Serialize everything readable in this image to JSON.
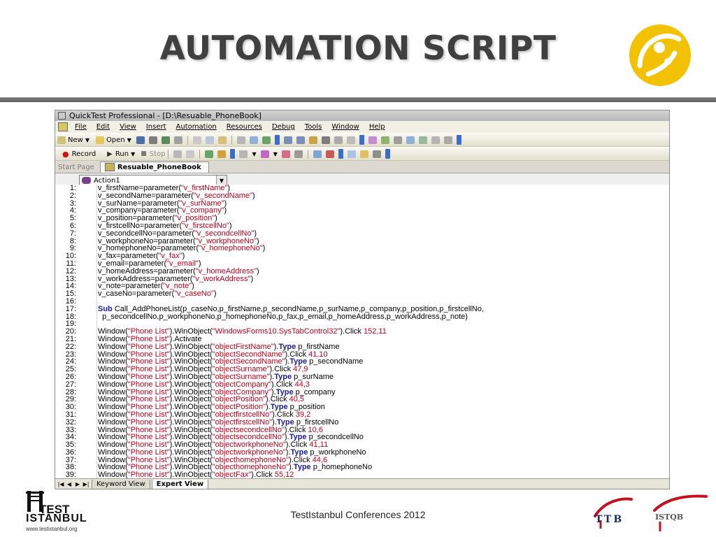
{
  "slide": {
    "title": "AUTOMATION SCRIPT",
    "footer_text": "TestIstanbul Conferences 2012",
    "logo_test": "TEST",
    "logo_istanbul": "ISTANBUL",
    "logo_url": "www.testistanbul.org",
    "ttb_label": "TTB",
    "istqb_label": "ISTQB",
    "brand_color": "#f2c200"
  },
  "app": {
    "title": "QuickTest Professional - [D:\\Resuable_PhoneBook]",
    "menu": [
      "File",
      "Edit",
      "View",
      "Insert",
      "Automation",
      "Resources",
      "Debug",
      "Tools",
      "Window",
      "Help"
    ],
    "toolbar1": {
      "new_label": "New",
      "open_label": "Open"
    },
    "toolbar2": {
      "record_label": "Record",
      "run_label": "Run",
      "stop_label": "Stop"
    },
    "tabs": {
      "start": "Start Page",
      "doc": "Resuable_PhoneBook"
    },
    "action_select": "Action1",
    "bottom_tabs": [
      "Keyword View",
      "Expert View"
    ]
  },
  "code_lines": [
    {
      "n": "1:",
      "t": [
        [
          "v_firstName=parameter(",
          ""
        ],
        [
          "\"v_firstName\"",
          "s"
        ],
        [
          ")",
          ""
        ]
      ]
    },
    {
      "n": "2:",
      "t": [
        [
          "v_secondName=parameter(",
          ""
        ],
        [
          "\"v_secondName\"",
          "s"
        ],
        [
          ")",
          ""
        ]
      ]
    },
    {
      "n": "3:",
      "t": [
        [
          "v_surName=parameter(",
          ""
        ],
        [
          "\"v_surName\"",
          "s"
        ],
        [
          ")",
          ""
        ]
      ]
    },
    {
      "n": "4:",
      "t": [
        [
          "v_company=parameter(",
          ""
        ],
        [
          "\"v_company\"",
          "s"
        ],
        [
          ")",
          ""
        ]
      ]
    },
    {
      "n": "5:",
      "t": [
        [
          "v_position=parameter(",
          ""
        ],
        [
          "\"v_position\"",
          "s"
        ],
        [
          ")",
          ""
        ]
      ]
    },
    {
      "n": "6:",
      "t": [
        [
          "v_firstcellNo=parameter(",
          ""
        ],
        [
          "\"v_firstcellNo\"",
          "s"
        ],
        [
          ")",
          ""
        ]
      ]
    },
    {
      "n": "7:",
      "t": [
        [
          "v_secondcellNo=parameter(",
          ""
        ],
        [
          "\"v_secondcellNo\"",
          "s"
        ],
        [
          ")",
          ""
        ]
      ]
    },
    {
      "n": "8:",
      "t": [
        [
          "v_workphoneNo=parameter(",
          ""
        ],
        [
          "\"v_workphoneNo\"",
          "s"
        ],
        [
          ")",
          ""
        ]
      ]
    },
    {
      "n": "9:",
      "t": [
        [
          "v_homephoneNo=parameter(",
          ""
        ],
        [
          "\"v_homephoneNo\"",
          "s"
        ],
        [
          ")",
          ""
        ]
      ]
    },
    {
      "n": "10:",
      "t": [
        [
          "v_fax=parameter(",
          ""
        ],
        [
          "\"v_fax\"",
          "s"
        ],
        [
          ")",
          ""
        ]
      ]
    },
    {
      "n": "11:",
      "t": [
        [
          "v_email=parameter(",
          ""
        ],
        [
          "\"v_email\"",
          "s"
        ],
        [
          ")",
          ""
        ]
      ]
    },
    {
      "n": "12:",
      "t": [
        [
          "v_homeAddress=parameter(",
          ""
        ],
        [
          "\"v_homeAddress\"",
          "s"
        ],
        [
          ")",
          ""
        ]
      ]
    },
    {
      "n": "13:",
      "t": [
        [
          "v_workAddress=parameter(",
          ""
        ],
        [
          "\"v_workAddress\"",
          "s"
        ],
        [
          ")",
          ""
        ]
      ]
    },
    {
      "n": "14:",
      "t": [
        [
          "v_note=parameter(",
          ""
        ],
        [
          "\"v_note\"",
          "s"
        ],
        [
          ")",
          ""
        ]
      ]
    },
    {
      "n": "15:",
      "t": [
        [
          "v_caseNo=parameter(",
          ""
        ],
        [
          "\"v_caseNo\"",
          "s"
        ],
        [
          ")",
          ""
        ]
      ]
    },
    {
      "n": "16:",
      "t": []
    },
    {
      "n": "17:",
      "t": [
        [
          "Sub",
          "k"
        ],
        [
          " Call_AddPhoneList(p_caseNo,p_firstName,p_secondName,p_surName,p_company,p_position,p_firstcellNo,",
          ""
        ]
      ]
    },
    {
      "n": "18:",
      "t": [
        [
          "  p_secondcellNo,p_workphoneNo,p_homephoneNo,p_fax,p_email,p_homeAddress,p_workAddress,p_note)",
          ""
        ]
      ]
    },
    {
      "n": "19:",
      "t": []
    },
    {
      "n": "20:",
      "t": [
        [
          "Window(",
          ""
        ],
        [
          "\"Phone List\"",
          "s"
        ],
        [
          ").WinObject(",
          ""
        ],
        [
          "\"WindowsForms10.SysTabControl32\"",
          "s"
        ],
        [
          ").Click ",
          ""
        ],
        [
          "152,11",
          "n"
        ]
      ]
    },
    {
      "n": "21:",
      "t": [
        [
          "Window(",
          ""
        ],
        [
          "\"Phone List\"",
          "s"
        ],
        [
          ").Activate",
          ""
        ]
      ]
    },
    {
      "n": "22:",
      "t": [
        [
          "Window(",
          ""
        ],
        [
          "\"Phone List\"",
          "s"
        ],
        [
          ").WinObject(",
          ""
        ],
        [
          "\"objectFirstName\"",
          "s"
        ],
        [
          ").",
          ""
        ],
        [
          "Type",
          "k"
        ],
        [
          " p_firstName",
          ""
        ]
      ]
    },
    {
      "n": "23:",
      "t": [
        [
          "Window(",
          ""
        ],
        [
          "\"Phone List\"",
          "s"
        ],
        [
          ").WinObject(",
          ""
        ],
        [
          "\"objectSecondName\"",
          "s"
        ],
        [
          ").Click ",
          ""
        ],
        [
          "41,10",
          "n"
        ]
      ]
    },
    {
      "n": "24:",
      "t": [
        [
          "Window(",
          ""
        ],
        [
          "\"Phone List\"",
          "s"
        ],
        [
          ").WinObject(",
          ""
        ],
        [
          "\"objectSecondName\"",
          "s"
        ],
        [
          ").",
          ""
        ],
        [
          "Type",
          "k"
        ],
        [
          " p_secondName",
          ""
        ]
      ]
    },
    {
      "n": "25:",
      "t": [
        [
          "Window(",
          ""
        ],
        [
          "\"Phone List\"",
          "s"
        ],
        [
          ").WinObject(",
          ""
        ],
        [
          "\"objectSurname\"",
          "s"
        ],
        [
          ").Click ",
          ""
        ],
        [
          "47,9",
          "n"
        ]
      ]
    },
    {
      "n": "26:",
      "t": [
        [
          "Window(",
          ""
        ],
        [
          "\"Phone List\"",
          "s"
        ],
        [
          ").WinObject(",
          ""
        ],
        [
          "\"objectSurname\"",
          "s"
        ],
        [
          ").",
          ""
        ],
        [
          "Type",
          "k"
        ],
        [
          " p_surName",
          ""
        ]
      ]
    },
    {
      "n": "27:",
      "t": [
        [
          "Window(",
          ""
        ],
        [
          "\"Phone List\"",
          "s"
        ],
        [
          ").WinObject(",
          ""
        ],
        [
          "\"objectCompany\"",
          "s"
        ],
        [
          ").Click ",
          ""
        ],
        [
          "44,3",
          "n"
        ]
      ]
    },
    {
      "n": "28:",
      "t": [
        [
          "Window(",
          ""
        ],
        [
          "\"Phone List\"",
          "s"
        ],
        [
          ").WinObject(",
          ""
        ],
        [
          "\"objectCompany\"",
          "s"
        ],
        [
          ").",
          ""
        ],
        [
          "Type",
          "k"
        ],
        [
          " p_company",
          ""
        ]
      ]
    },
    {
      "n": "29:",
      "t": [
        [
          "Window(",
          ""
        ],
        [
          "\"Phone List\"",
          "s"
        ],
        [
          ").WinObject(",
          ""
        ],
        [
          "\"objectPosition\"",
          "s"
        ],
        [
          ").Click ",
          ""
        ],
        [
          "40,5",
          "n"
        ]
      ]
    },
    {
      "n": "30:",
      "t": [
        [
          "Window(",
          ""
        ],
        [
          "\"Phone List\"",
          "s"
        ],
        [
          ").WinObject(",
          ""
        ],
        [
          "\"objectPosition\"",
          "s"
        ],
        [
          ").",
          ""
        ],
        [
          "Type",
          "k"
        ],
        [
          " p_position",
          ""
        ]
      ]
    },
    {
      "n": "31:",
      "t": [
        [
          "Window(",
          ""
        ],
        [
          "\"Phone List\"",
          "s"
        ],
        [
          ").WinObject(",
          ""
        ],
        [
          "\"objectfirstcellNo\"",
          "s"
        ],
        [
          ").Click ",
          ""
        ],
        [
          "39,2",
          "n"
        ]
      ]
    },
    {
      "n": "32:",
      "t": [
        [
          "Window(",
          ""
        ],
        [
          "\"Phone List\"",
          "s"
        ],
        [
          ").WinObject(",
          ""
        ],
        [
          "\"objectfirstcellNo\"",
          "s"
        ],
        [
          ").",
          ""
        ],
        [
          "Type",
          "k"
        ],
        [
          " p_firstcellNo",
          ""
        ]
      ]
    },
    {
      "n": "33:",
      "t": [
        [
          "Window(",
          ""
        ],
        [
          "\"Phone List\"",
          "s"
        ],
        [
          ").WinObject(",
          ""
        ],
        [
          "\"objectsecondcellNo\"",
          "s"
        ],
        [
          ").Click ",
          ""
        ],
        [
          "10,6",
          "n"
        ]
      ]
    },
    {
      "n": "34:",
      "t": [
        [
          "Window(",
          ""
        ],
        [
          "\"Phone List\"",
          "s"
        ],
        [
          ").WinObject(",
          ""
        ],
        [
          "\"objectsecondcellNo\"",
          "s"
        ],
        [
          ").",
          ""
        ],
        [
          "Type",
          "k"
        ],
        [
          " p_secondcellNo",
          ""
        ]
      ]
    },
    {
      "n": "35:",
      "t": [
        [
          "Window(",
          ""
        ],
        [
          "\"Phone List\"",
          "s"
        ],
        [
          ").WinObject(",
          ""
        ],
        [
          "\"objectworkphoneNo\"",
          "s"
        ],
        [
          ").Click ",
          ""
        ],
        [
          "41,11",
          "n"
        ]
      ]
    },
    {
      "n": "36:",
      "t": [
        [
          "Window(",
          ""
        ],
        [
          "\"Phone List\"",
          "s"
        ],
        [
          ").WinObject(",
          ""
        ],
        [
          "\"objectworkphoneNo\"",
          "s"
        ],
        [
          ").",
          ""
        ],
        [
          "Type",
          "k"
        ],
        [
          " p_workphoneNo",
          ""
        ]
      ]
    },
    {
      "n": "37:",
      "t": [
        [
          "Window(",
          ""
        ],
        [
          "\"Phone List\"",
          "s"
        ],
        [
          ").WinObject(",
          ""
        ],
        [
          "\"objecthomephoneNo\"",
          "s"
        ],
        [
          ").Click ",
          ""
        ],
        [
          "44,6",
          "n"
        ]
      ]
    },
    {
      "n": "38:",
      "t": [
        [
          "Window(",
          ""
        ],
        [
          "\"Phone List\"",
          "s"
        ],
        [
          ").WinObject(",
          ""
        ],
        [
          "\"objecthomephoneNo\"",
          "s"
        ],
        [
          ").",
          ""
        ],
        [
          "Type",
          "k"
        ],
        [
          " p_homephoneNo",
          ""
        ]
      ]
    },
    {
      "n": "39:",
      "t": [
        [
          "Window(",
          ""
        ],
        [
          "\"Phone List\"",
          "s"
        ],
        [
          ").WinObject(",
          ""
        ],
        [
          "\"objectFax\"",
          "s"
        ],
        [
          ").Click ",
          ""
        ],
        [
          "55,12",
          "n"
        ]
      ]
    }
  ]
}
